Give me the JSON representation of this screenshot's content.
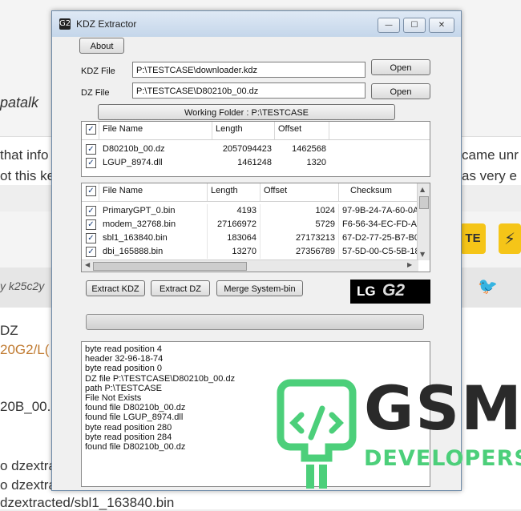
{
  "background": {
    "snippets": [
      {
        "id": "patalk",
        "text": "patalk"
      },
      {
        "id": "that-info",
        "text": "that info"
      },
      {
        "id": "ot-this",
        "text": "ot this ke"
      },
      {
        "id": "came-unr",
        "text": "came unr"
      },
      {
        "id": "as-very",
        "text": "as very e"
      },
      {
        "id": "te-badge",
        "text": "TE"
      },
      {
        "id": "by-user",
        "text": "y k25c2y"
      },
      {
        "id": "dz",
        "text": "DZ"
      },
      {
        "id": "link",
        "text": "20G2/L("
      },
      {
        "id": "file",
        "text": "20B_00."
      },
      {
        "id": "p1",
        "text": "o dzextra"
      },
      {
        "id": "p2",
        "text": "o dzextra"
      },
      {
        "id": "path",
        "text": "dzextracted/sbl1_163840.bin"
      }
    ]
  },
  "window": {
    "title": "KDZ Extractor",
    "icon_text": "G2",
    "controls": {
      "minimize": "—",
      "maximize": "☐",
      "close": "✕"
    }
  },
  "about_label": "About",
  "kdz": {
    "label": "KDZ File",
    "value": "P:\\TESTCASE\\downloader.kdz",
    "open_label": "Open"
  },
  "dz": {
    "label": "DZ File",
    "value": "P:\\TESTCASE\\D80210b_00.dz",
    "open_label": "Open"
  },
  "working_folder_label": "Working Folder : P:\\TESTCASE",
  "dz_table": {
    "headers": {
      "name": "File Name",
      "length": "Length",
      "offset": "Offset"
    },
    "rows": [
      {
        "name": "D80210b_00.dz",
        "length": "2057094423",
        "offset": "1462568"
      },
      {
        "name": "LGUP_8974.dll",
        "length": "1461248",
        "offset": "1320"
      }
    ]
  },
  "part_table": {
    "headers": {
      "name": "File Name",
      "length": "Length",
      "offset": "Offset",
      "checksum": "Checksum"
    },
    "rows": [
      {
        "name": "PrimaryGPT_0.bin",
        "length": "4193",
        "offset": "1024",
        "checksum": "97-9B-24-7A-60-0A"
      },
      {
        "name": "modem_32768.bin",
        "length": "27166972",
        "offset": "5729",
        "checksum": "F6-56-34-EC-FD-AC"
      },
      {
        "name": "sbl1_163840.bin",
        "length": "183064",
        "offset": "27173213",
        "checksum": "67-D2-77-25-B7-B0"
      },
      {
        "name": "dbi_165888.bin",
        "length": "13270",
        "offset": "27356789",
        "checksum": "57-5D-00-C5-5B-18"
      }
    ]
  },
  "buttons": {
    "extract_kdz": "Extract KDZ",
    "extract_dz": "Extract DZ",
    "merge": "Merge System-bin"
  },
  "lg_logo": {
    "text": "LG",
    "model": "G2"
  },
  "progress": 0,
  "log": [
    "byte read position 4",
    "header  32-96-18-74",
    "byte read position 0",
    "DZ file P:\\TESTCASE\\D80210b_00.dz",
    "path P:\\TESTCASE",
    "File Not Exists",
    "found file D80210b_00.dz",
    "found file LGUP_8974.dll",
    "byte read position 280",
    "byte read position 284",
    "found file D80210b_00.dz"
  ],
  "watermark": {
    "brand": "GSM",
    "sub": "DEVELOPERS",
    "color": "#4ccf7a"
  }
}
